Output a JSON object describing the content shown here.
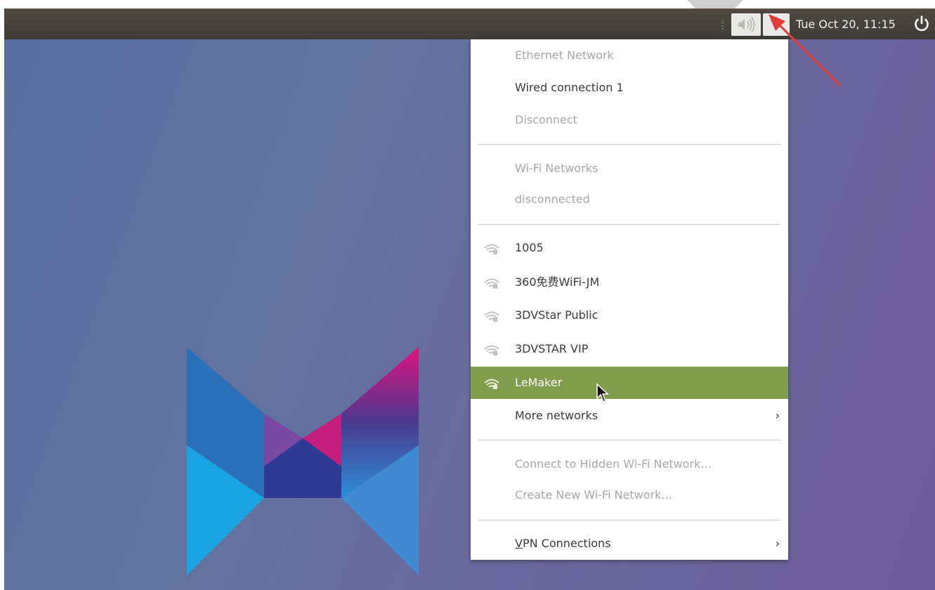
{
  "panel": {
    "clock": "Tue Oct 20, 11:15"
  },
  "menu": {
    "ethernet_header": "Ethernet Network",
    "wired_connection": "Wired connection 1",
    "disconnect": "Disconnect",
    "wifi_header": "Wi-Fi Networks",
    "wifi_status": "disconnected",
    "networks": [
      "1005",
      "360免费WiFi-JM",
      "3DVStar Public",
      "3DVSTAR VIP",
      "LeMaker"
    ],
    "selected_network": "LeMaker",
    "more_networks": "More networks",
    "connect_hidden": "Connect to Hidden Wi-Fi Network...",
    "create_new": "Create New Wi-Fi Network...",
    "vpn_underlined_letter": "V",
    "vpn_rest": "PN Connections",
    "chevron": "›"
  },
  "colors": {
    "selection": "#7f9d4c",
    "panel": "#3e3c36",
    "annotation_arrow": "#e03a3a"
  },
  "icons": [
    "sound-icon",
    "network-icon",
    "power-icon",
    "wifi-signal-icon",
    "chevron-right-icon",
    "mouse-cursor-icon"
  ]
}
